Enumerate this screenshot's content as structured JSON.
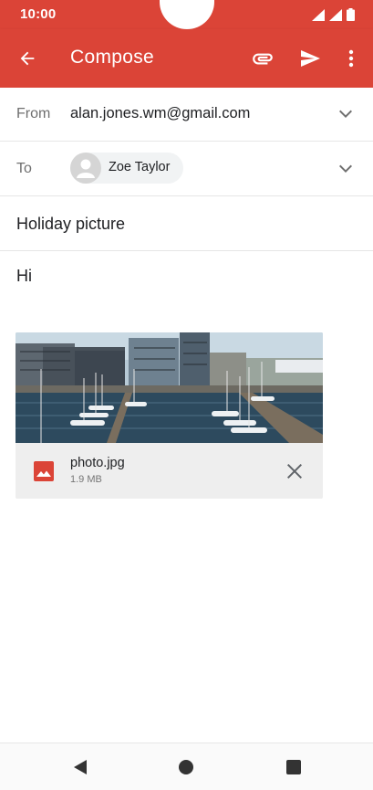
{
  "status_bar": {
    "time": "10:00"
  },
  "app_bar": {
    "title": "Compose",
    "back_icon": "arrow-back-icon",
    "attach_icon": "paperclip-icon",
    "send_icon": "send-icon",
    "more_icon": "more-vert-icon",
    "color": "#db4437"
  },
  "from": {
    "label": "From",
    "value": "alan.jones.wm@gmail.com"
  },
  "to": {
    "label": "To",
    "recipients": [
      {
        "name": "Zoe Taylor"
      }
    ]
  },
  "subject": {
    "value": "Holiday picture"
  },
  "body": {
    "text": "Hi"
  },
  "attachment": {
    "file_name": "photo.jpg",
    "file_size": "1.9 MB",
    "type_icon": "image-icon",
    "remove_icon": "close-icon"
  },
  "nav_bar": {
    "back_icon": "triangle-back-icon",
    "home_icon": "circle-home-icon",
    "recent_icon": "square-recent-icon"
  }
}
